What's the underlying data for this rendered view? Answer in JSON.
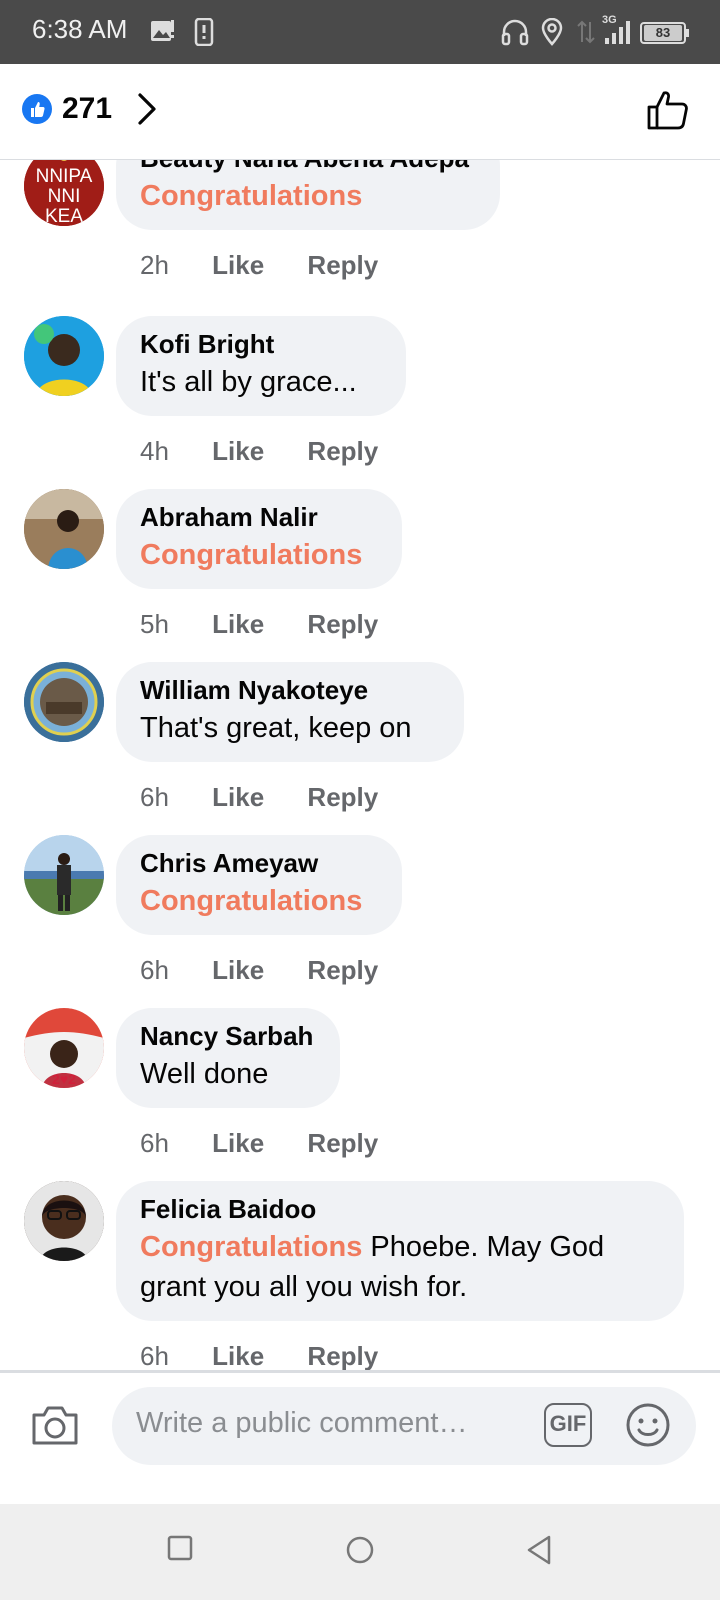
{
  "status_bar": {
    "time": "6:38 AM",
    "network": "3G",
    "battery": "83",
    "icons": [
      "gallery-notification-icon",
      "phone-notification-icon",
      "headphones-icon",
      "location-icon",
      "data-arrows-icon",
      "signal-icon",
      "battery-icon"
    ]
  },
  "header": {
    "reaction_count": "271",
    "colors": {
      "like_blue": "#1877f2"
    }
  },
  "comments": [
    {
      "author": "Beauty Nana Abena Adepa",
      "highlight": "Congratulations",
      "text": "",
      "age": "2h",
      "like": "Like",
      "reply": "Reply",
      "avatar_text": "NNIPA NNI KEA"
    },
    {
      "author": "Kofi Bright",
      "highlight": "",
      "text": "It's all by grace...",
      "age": "4h",
      "like": "Like",
      "reply": "Reply"
    },
    {
      "author": "Abraham Nalir",
      "highlight": "Congratulations",
      "text": "",
      "age": "5h",
      "like": "Like",
      "reply": "Reply"
    },
    {
      "author": "William Nyakoteye",
      "highlight": "",
      "text": "That's great, keep on",
      "age": "6h",
      "like": "Like",
      "reply": "Reply"
    },
    {
      "author": "Chris Ameyaw",
      "highlight": "Congratulations",
      "text": "",
      "age": "6h",
      "like": "Like",
      "reply": "Reply"
    },
    {
      "author": "Nancy Sarbah",
      "highlight": "",
      "text": "Well done",
      "age": "6h",
      "like": "Like",
      "reply": "Reply"
    },
    {
      "author": "Felicia Baidoo",
      "highlight": "Congratulations",
      "text": " Phoebe.  May God grant you all you wish for.",
      "age": "6h",
      "like": "Like",
      "reply": "Reply"
    }
  ],
  "composer": {
    "placeholder": "Write a public comment…",
    "gif_label": "GIF"
  },
  "colors": {
    "highlight": "#f07b5e",
    "bubble": "#f0f2f5",
    "meta_text": "#65676b"
  }
}
